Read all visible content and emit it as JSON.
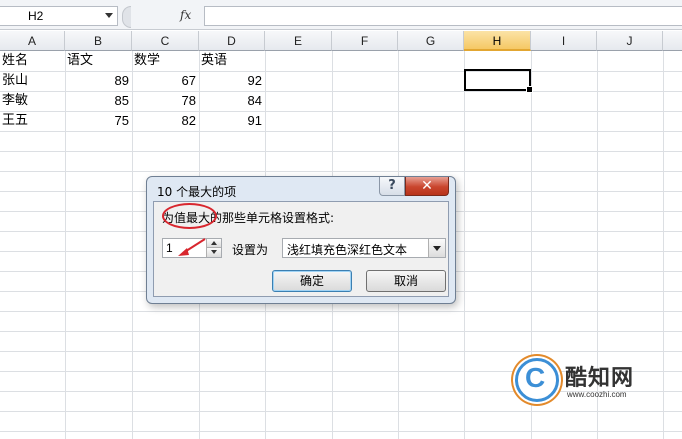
{
  "formula_bar": {
    "name_box": "H2",
    "fx_label": "fx",
    "formula": ""
  },
  "columns": [
    "A",
    "B",
    "C",
    "D",
    "E",
    "F",
    "G",
    "H",
    "I",
    "J"
  ],
  "selected_column": "H",
  "rows": [
    [
      "姓名",
      "语文",
      "数学",
      "英语"
    ],
    [
      "张山",
      "89",
      "67",
      "92"
    ],
    [
      "李敏",
      "85",
      "78",
      "84"
    ],
    [
      "王五",
      "75",
      "82",
      "91"
    ]
  ],
  "dialog": {
    "title": "10 个最大的项",
    "help_label": "?",
    "close_label": "✕",
    "prompt": "为值最大的那些单元格设置格式:",
    "count_value": "1",
    "set_label": "设置为",
    "format_option": "浅红填充色深红色文本",
    "ok_label": "确定",
    "cancel_label": "取消"
  },
  "annotation": {
    "color": "#d8262e"
  },
  "watermark": {
    "logo_letter": "C",
    "name": "酷知网",
    "url": "www.coozhi.com"
  }
}
